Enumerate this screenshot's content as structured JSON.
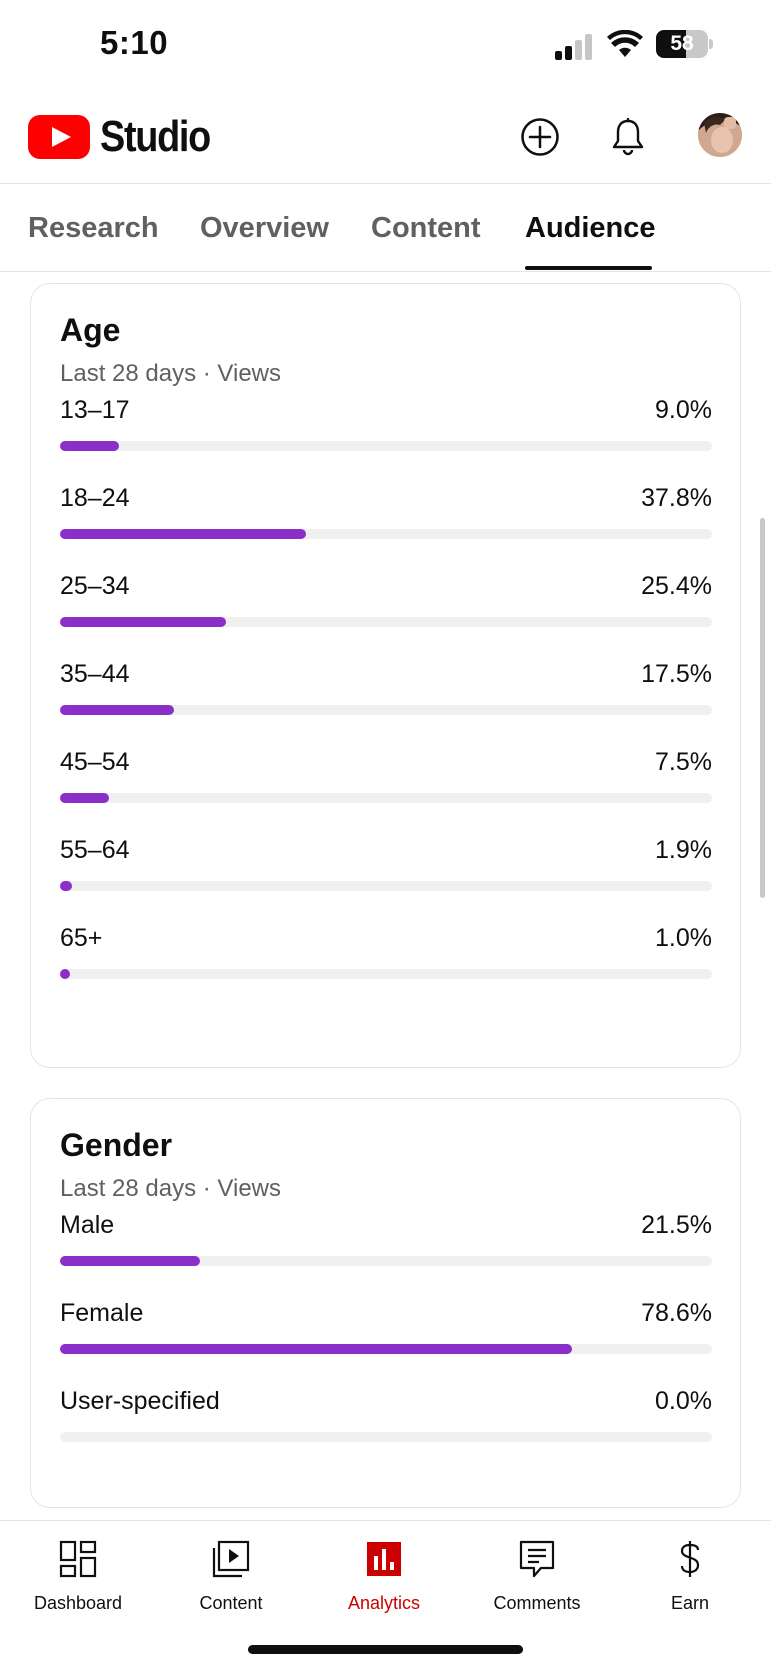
{
  "status_bar": {
    "time": "5:10",
    "battery": "58",
    "battery_level": 0.58
  },
  "header": {
    "logo_text": "Studio",
    "logo_icon": "youtube-play-logo",
    "brand_color": "#ff0000",
    "create_icon": "plus-circle-icon",
    "notifications_icon": "bell-icon",
    "avatar_icon": "profile-avatar"
  },
  "tabs": [
    {
      "label": "Research",
      "active": false
    },
    {
      "label": "Overview",
      "active": false
    },
    {
      "label": "Content",
      "active": false
    },
    {
      "label": "Audience",
      "active": true
    }
  ],
  "accent_color": "#8b2fc9",
  "age_card": {
    "title": "Age",
    "subtitle": "Last 28 days · Views",
    "rows": [
      {
        "label": "13–17",
        "value": "9.0%",
        "percent": 9.0
      },
      {
        "label": "18–24",
        "value": "37.8%",
        "percent": 37.8
      },
      {
        "label": "25–34",
        "value": "25.4%",
        "percent": 25.4
      },
      {
        "label": "35–44",
        "value": "17.5%",
        "percent": 17.5
      },
      {
        "label": "45–54",
        "value": "7.5%",
        "percent": 7.5
      },
      {
        "label": "55–64",
        "value": "1.9%",
        "percent": 1.9
      },
      {
        "label": "65+",
        "value": "1.0%",
        "percent": 1.0
      }
    ]
  },
  "gender_card": {
    "title": "Gender",
    "subtitle": "Last 28 days · Views",
    "rows": [
      {
        "label": "Male",
        "value": "21.5%",
        "percent": 21.5
      },
      {
        "label": "Female",
        "value": "78.6%",
        "percent": 78.6
      },
      {
        "label": "User-specified",
        "value": "0.0%",
        "percent": 0.0
      }
    ]
  },
  "bottom_nav": {
    "active_color": "#cc0000",
    "items": [
      {
        "label": "Dashboard",
        "icon": "dashboard-grid-icon",
        "active": false
      },
      {
        "label": "Content",
        "icon": "video-library-icon",
        "active": false
      },
      {
        "label": "Analytics",
        "icon": "analytics-bar-chart-icon",
        "active": true
      },
      {
        "label": "Comments",
        "icon": "comment-icon",
        "active": false
      },
      {
        "label": "Earn",
        "icon": "dollar-icon",
        "active": false
      }
    ]
  }
}
